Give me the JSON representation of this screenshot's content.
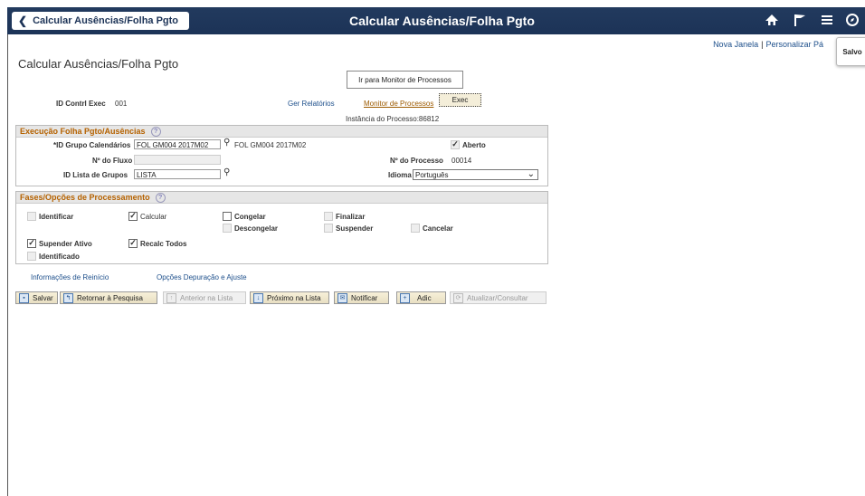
{
  "header": {
    "back_label": "Calcular Ausências/Folha Pgto",
    "title": "Calcular Ausências/Folha Pgto",
    "icons": [
      "home-icon",
      "flag-icon",
      "menu-icon",
      "compass-icon"
    ]
  },
  "toplinks": {
    "new_window": "Nova Janela",
    "separator": "|",
    "personalize": "Personalizar Pá"
  },
  "saved_popup": "Salvo",
  "page_title": "Calcular Ausências/Folha Pgto",
  "tooltip": "Ir para Monitor de Processos",
  "run_control": {
    "label": "ID Contrl Exec",
    "value": "001"
  },
  "links": {
    "reports": "Ger Relatórios",
    "monitor": "Monitor de Processos",
    "exec": "Exec",
    "instance": "Instância do Processo:86812"
  },
  "section1": {
    "title": "Execução Folha Pgto/Ausências",
    "calendar_group_label": "*ID Grupo Calendários",
    "calendar_group_value": "FOL GM004 2017M02",
    "calendar_group_desc": "FOL GM004 2017M02",
    "open_label": "Aberto",
    "flow_label": "Nº do Fluxo",
    "flow_value": "",
    "process_no_label": "Nº do Processo",
    "process_no_value": "00014",
    "group_list_label": "ID Lista de Grupos",
    "group_list_value": "LISTA",
    "language_label": "Idioma",
    "language_value": "Português"
  },
  "section2": {
    "title": "Fases/Opções de Processamento",
    "identify": "Identificar",
    "calculate": "Calcular",
    "freeze": "Congelar",
    "unfreeze": "Descongelar",
    "finalize": "Finalizar",
    "suspend": "Suspender",
    "cancel": "Cancelar",
    "suspend_active": "Supender Ativo",
    "recalc_all": "Recalc Todos",
    "identified": "Identificado"
  },
  "bottom_links": {
    "restart": "Informações de Reinício",
    "debug": "Opções Depuração e Ajuste"
  },
  "toolbar": {
    "save": "Salvar",
    "return": "Retornar à Pesquisa",
    "prev": "Anterior na Lista",
    "next": "Próximo na Lista",
    "notify": "Notificar",
    "add": "Adic",
    "update": "Atualizar/Consultar"
  }
}
